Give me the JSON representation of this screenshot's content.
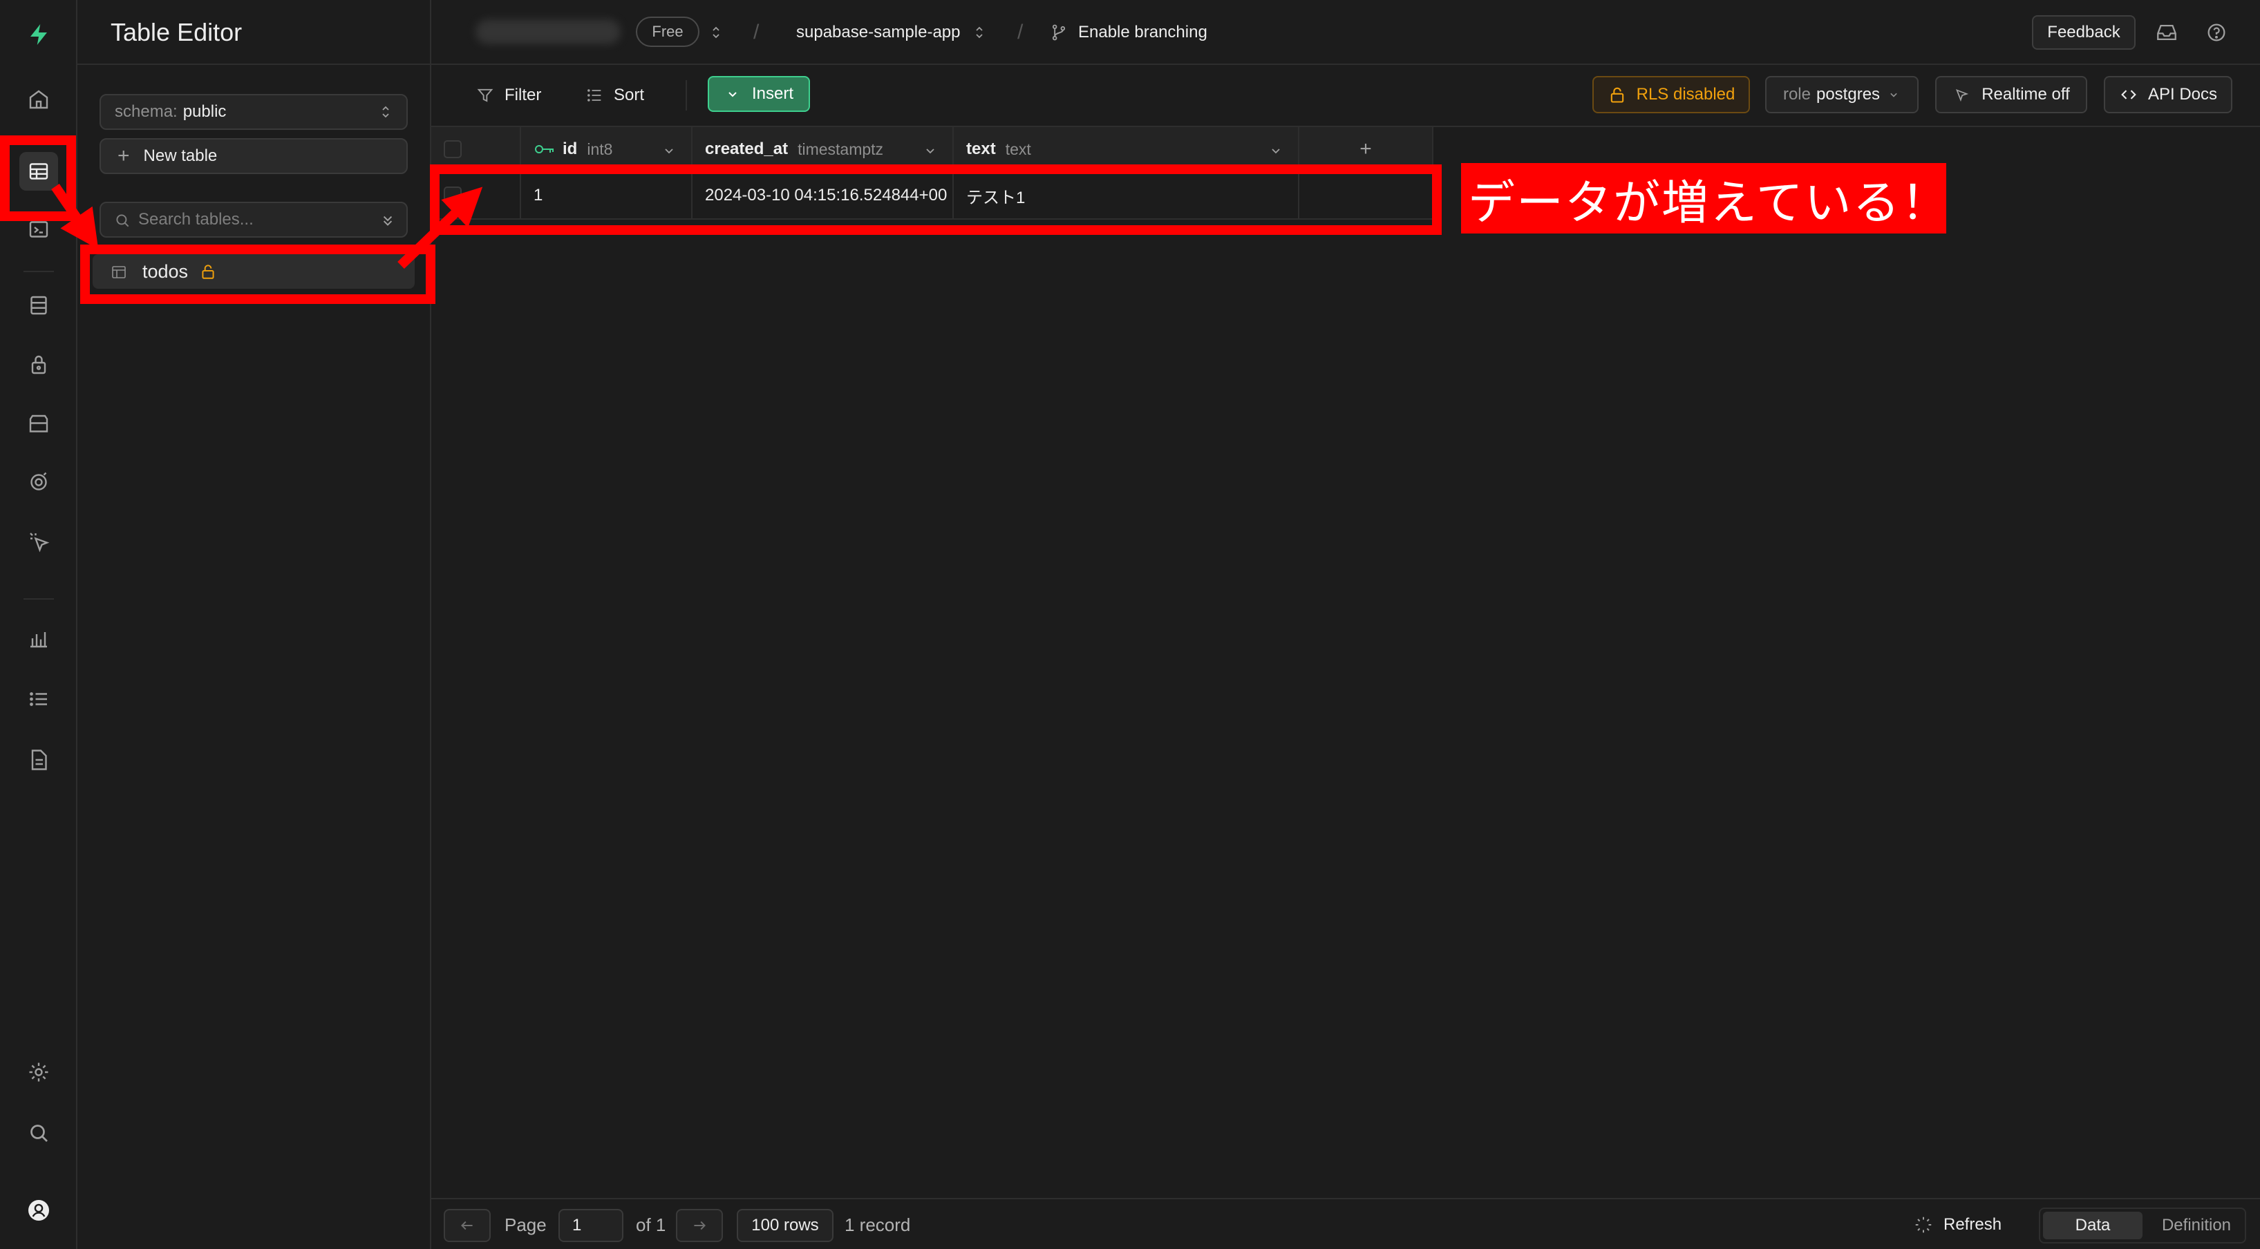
{
  "sidebar": {
    "title": "Table Editor",
    "schema_label": "schema:",
    "schema_value": "public",
    "new_table_label": "New table",
    "search_placeholder": "Search tables...",
    "table_name": "todos"
  },
  "topbar": {
    "plan_badge": "Free",
    "project_name": "supabase-sample-app",
    "branching_label": "Enable branching",
    "feedback_label": "Feedback",
    "separator": "/"
  },
  "toolbar": {
    "filter_label": "Filter",
    "sort_label": "Sort",
    "insert_label": "Insert",
    "rls_label": "RLS disabled",
    "role_label": "role",
    "role_value": "postgres",
    "realtime_label": "Realtime off",
    "api_docs_label": "API Docs"
  },
  "grid": {
    "columns": [
      {
        "name": "id",
        "type": "int8"
      },
      {
        "name": "created_at",
        "type": "timestamptz"
      },
      {
        "name": "text",
        "type": "text"
      }
    ],
    "add_column_symbol": "+",
    "rows": [
      {
        "id": "1",
        "created_at": "2024-03-10 04:15:16.524844+00",
        "text": "テスト1"
      }
    ]
  },
  "annotation": {
    "label": "データが増えている！",
    "color": "#ff0000"
  },
  "footer": {
    "page_label": "Page",
    "page_value": "1",
    "of_label": "of 1",
    "rows_label": "100 rows",
    "record_count": "1 record",
    "refresh_label": "Refresh",
    "data_tab": "Data",
    "definition_tab": "Definition"
  },
  "colors": {
    "background": "#1c1c1c",
    "brand": "#3ecf8e",
    "warning": "#f1a10d"
  }
}
